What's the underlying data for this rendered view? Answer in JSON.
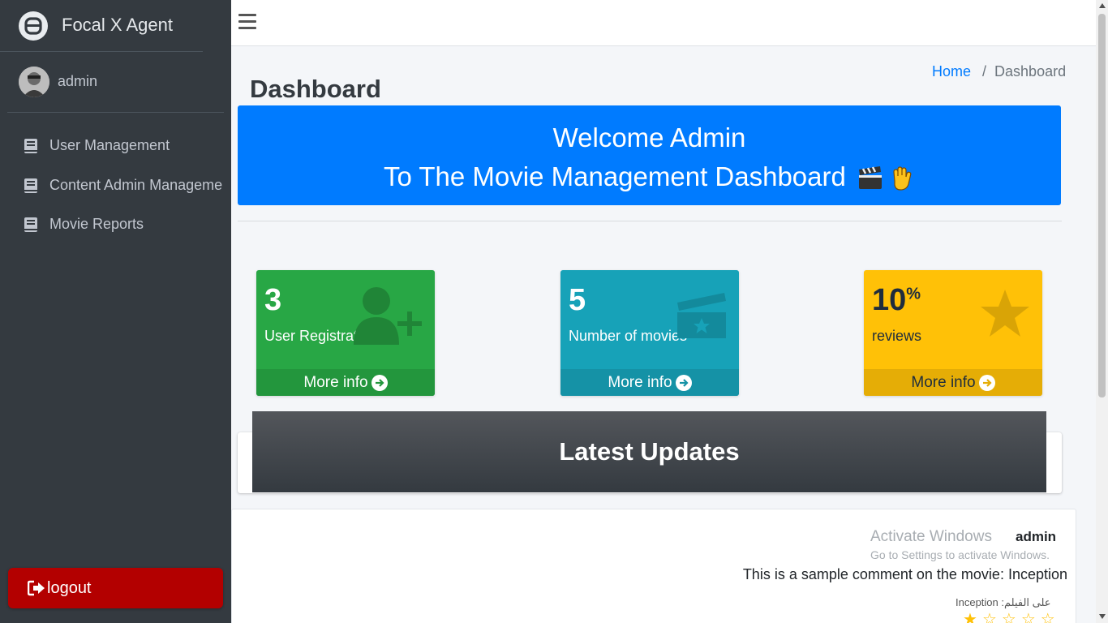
{
  "brand": {
    "name": "Focal X Agent"
  },
  "user": {
    "name": "admin"
  },
  "sidebar": {
    "items": [
      {
        "label": "User Management"
      },
      {
        "label": "Content Admin Manageme"
      },
      {
        "label": "Movie Reports"
      }
    ],
    "logout_label": "logout"
  },
  "header": {
    "page_title": "Dashboard",
    "breadcrumb": {
      "home": "Home",
      "sep": "/",
      "current": "Dashboard"
    }
  },
  "welcome": {
    "line1": "Welcome Admin",
    "line2": "To The Movie Management Dashboard"
  },
  "stats": [
    {
      "value": "3",
      "suffix": "",
      "label": "User Registrations",
      "more": "More info",
      "color": "#28a745",
      "icon": "user-plus-icon"
    },
    {
      "value": "5",
      "suffix": "",
      "label": "Number of movies",
      "more": "More info",
      "color": "#17a2b8",
      "icon": "film-icon"
    },
    {
      "value": "10",
      "suffix": "%",
      "label": "reviews",
      "more": "More info",
      "color": "#ffc107",
      "icon": "star-icon"
    }
  ],
  "updates": {
    "title": "Latest Updates"
  },
  "comment": {
    "author": "admin",
    "text": "This is a sample comment on the movie: Inception",
    "movie_line": "Inception :على الفيلم",
    "rating_filled": 1,
    "rating_total": 5
  },
  "watermark": {
    "title": "Activate Windows",
    "subtitle": "Go to Settings to activate Windows."
  }
}
